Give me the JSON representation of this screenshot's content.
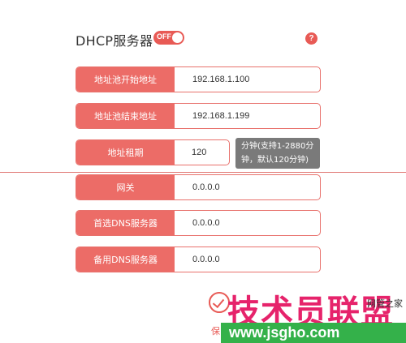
{
  "header": {
    "title": "DHCP服务器",
    "toggle_label": "OFF",
    "help_label": "?"
  },
  "fields": [
    {
      "label": "地址池开始地址",
      "value": "192.168.1.100"
    },
    {
      "label": "地址池结束地址",
      "value": "192.168.1.199"
    }
  ],
  "lease": {
    "label": "地址租期",
    "value": "120",
    "hint_line1": "分钟(支持1-2880分",
    "hint_line2": "钟，默认120分钟)"
  },
  "fields2": [
    {
      "label": "网关",
      "value": "0.0.0.0"
    },
    {
      "label": "首选DNS服务器",
      "value": "0.0.0.0"
    },
    {
      "label": "备用DNS服务器",
      "value": "0.0.0.0"
    }
  ],
  "save": {
    "label": "保"
  },
  "watermark": {
    "brand": "技术员联盟",
    "url": "www.jsgho.com",
    "sub": "网管之家"
  },
  "colors": {
    "accent": "#ec6c67",
    "tip_bg": "#7a7a7a",
    "watermark_pink": "#e6236b",
    "watermark_green": "#34b14a"
  }
}
